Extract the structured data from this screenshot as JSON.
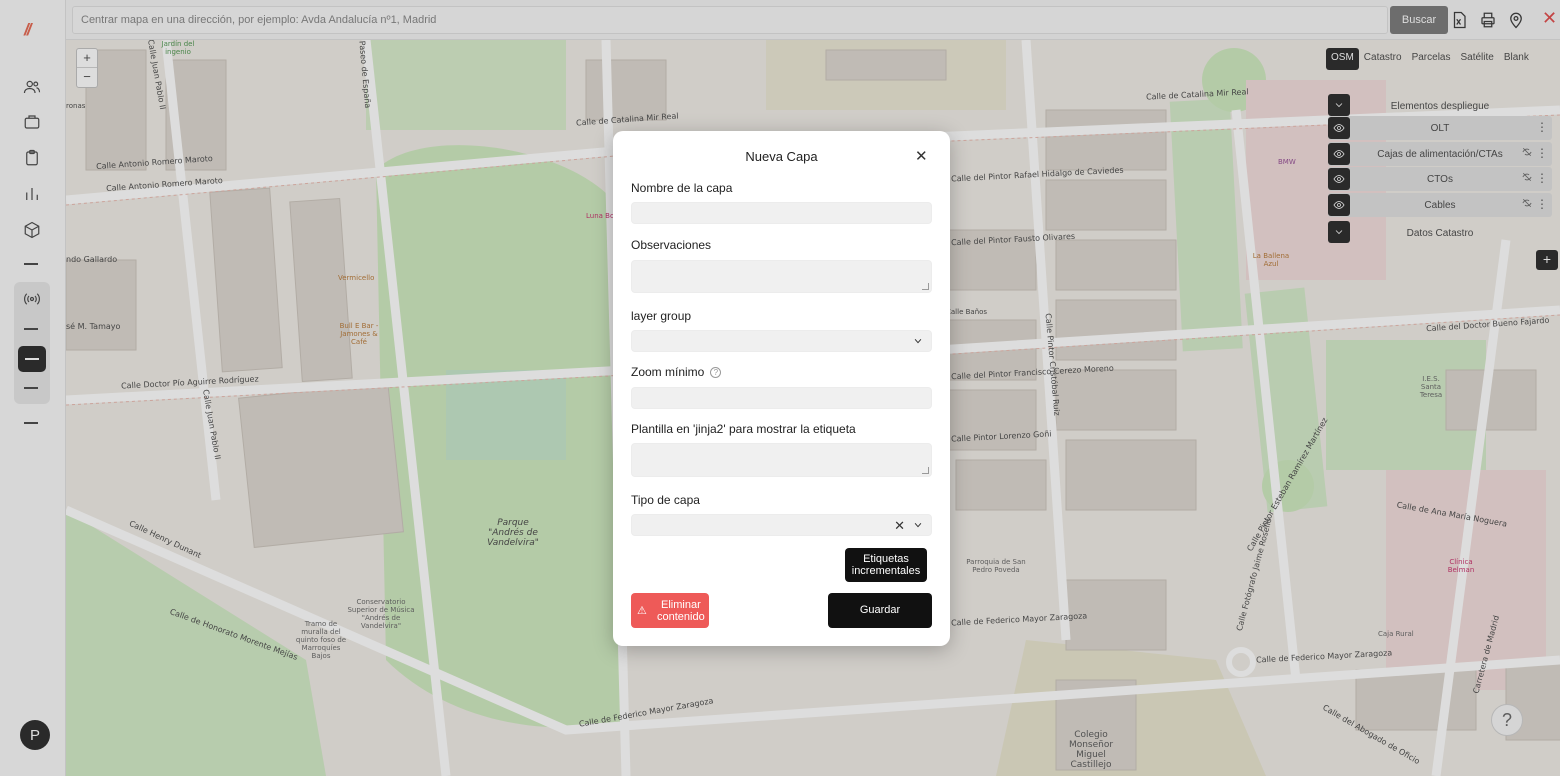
{
  "sidebar": {
    "logo": "//",
    "avatar_initial": "P",
    "icons": [
      "users-icon",
      "briefcase-icon",
      "clipboard-icon",
      "bar-chart-icon",
      "box-icon",
      "antenna-icon"
    ]
  },
  "topbar": {
    "search_placeholder": "Centrar mapa en una dirección, por ejemplo: Avda Andalucía nº1, Madrid",
    "search_button": "Buscar",
    "close_glyph": "✕"
  },
  "map": {
    "zoom_in": "+",
    "zoom_out": "−",
    "labels": [
      "Calle de Catalina Mir Real",
      "Calle de Catalina Mir Real",
      "Calle Antonio Romero Maroto",
      "Calle Antonio Romero Maroto",
      "ndo Gallardo",
      "sé M. Tamayo",
      "Calle Doctor Pío Aguirre Rodríguez",
      "Calle Juan Pablo II",
      "Calle Henry Dunant",
      "Calle de Honorato Morente Mejías",
      "Calle de Federico Mayor Zaragoza",
      "Calle de Federico Mayor Zaragoza",
      "Calle de Federico Mayor Zaragoza",
      "Calle del Pintor Rafael Hidalgo de Caviedes",
      "Calle del Pintor Fausto Olivares",
      "Calle del Pintor Francisco Cerezo Moreno",
      "Calle Pintor Lorenzo Goñi",
      "Calle del Doctor Bueno Fajardo",
      "Calle de Ana María Noguera",
      "Parque \"Andrés de Vandelvira\"",
      "Conservatorio Superior de Música \"Andrés de Vandelvira\"",
      "Tramo de muralla del quinto foso de Marroquíes Bajos",
      "Parroquia de San Pedro Poveda",
      "Colegio Monseñor Miguel Castillejo",
      "Vermicello",
      "Bull E Bar - Jamones & Café",
      "La Ballena Azul",
      "Jardín del ingenio",
      "Luna Bonita",
      "BMW",
      "I.E.S. Santa Teresa",
      "Clínica Belman",
      "Caja Rural",
      "Paseo de España",
      "Calle Pintor Cristóbal Ruiz",
      "Calle Juan Pablo II",
      "Calle Fotógrafo Jaime Roselló",
      "Carretera de Madrid",
      "Calle del Abogado de Oficio",
      "Calle Pintor Esteban Ramírez Martínez",
      "Calle Baños",
      "ronas"
    ]
  },
  "layers_panel": {
    "basemaps": [
      "OSM",
      "Catastro",
      "Parcelas",
      "Satélite",
      "Blank"
    ],
    "active_basemap": "OSM",
    "group_title": "Elementos despliegue",
    "rows": [
      "OLT",
      "Cajas de alimentación/CTAs",
      "CTOs",
      "Cables"
    ],
    "catastro_title": "Datos Catastro",
    "add_button": "+",
    "help_button": "?"
  },
  "modal": {
    "title": "Nueva Capa",
    "close": "✕",
    "fields": {
      "nombre_label": "Nombre de la capa",
      "nombre_value": "",
      "observaciones_label": "Observaciones",
      "observaciones_value": "",
      "layer_group_label": "layer group",
      "layer_group_value": "",
      "zoom_label": "Zoom mínimo",
      "zoom_help": "?",
      "zoom_value": "",
      "plantilla_label": "Plantilla en 'jinja2' para mostrar la etiqueta",
      "plantilla_value": "",
      "tipo_label": "Tipo de capa",
      "tipo_value": "",
      "clear_glyph": "✕"
    },
    "buttons": {
      "etiquetas_line1": "Etiquetas",
      "etiquetas_line2": "incrementales",
      "eliminar_line1": "Eliminar",
      "eliminar_line2": "contenido",
      "warning_glyph": "⚠",
      "guardar": "Guardar"
    }
  }
}
